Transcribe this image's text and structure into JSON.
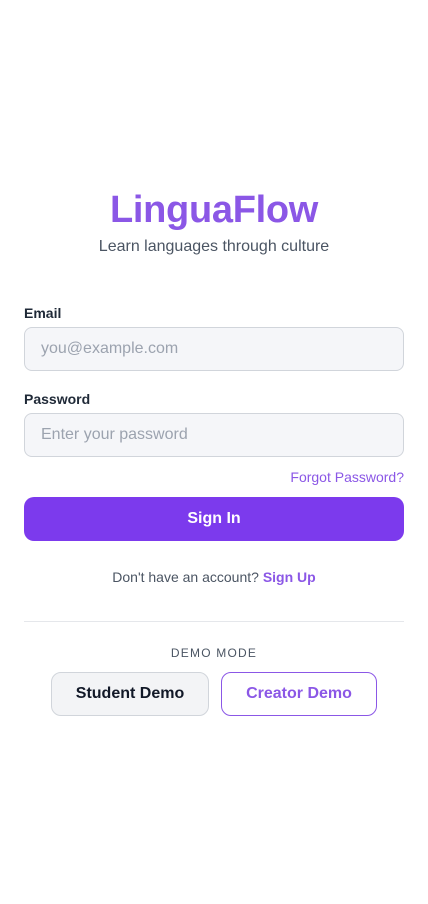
{
  "brand": {
    "title": "LinguaFlow",
    "tagline": "Learn languages through culture"
  },
  "form": {
    "email_label": "Email",
    "email_placeholder": "you@example.com",
    "email_value": "",
    "password_label": "Password",
    "password_placeholder": "Enter your password",
    "password_value": "",
    "forgot_label": "Forgot Password?",
    "submit_label": "Sign In"
  },
  "signup": {
    "prompt": "Don't have an account?",
    "link_label": "Sign Up"
  },
  "demo": {
    "heading": "DEMO MODE",
    "student_label": "Student Demo",
    "creator_label": "Creator Demo"
  },
  "colors": {
    "accent": "#7c3aed",
    "accent_text": "#8b57e6",
    "input_bg": "#f5f6f9"
  }
}
